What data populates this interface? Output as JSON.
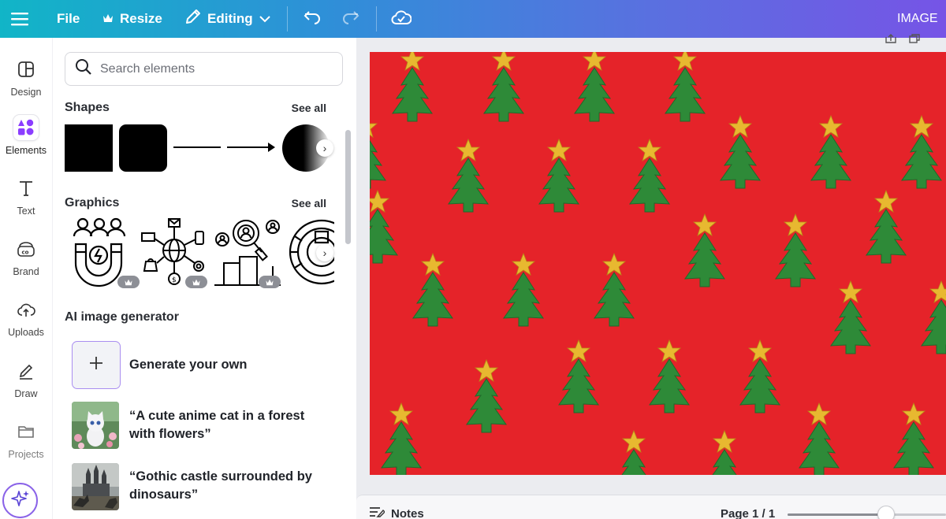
{
  "topbar": {
    "file_label": "File",
    "resize_label": "Resize",
    "mode_label": "Editing",
    "title_label": "IMAGE",
    "menu_icon": "hamburger-icon",
    "crown_icon": "crown-icon",
    "pencil_icon": "pencil-icon",
    "undo_icon": "undo-icon",
    "redo_icon": "redo-icon",
    "cloud_icon": "cloud-check-icon"
  },
  "rail": {
    "items": [
      {
        "label": "Design",
        "icon": "layout-icon"
      },
      {
        "label": "Elements",
        "icon": "shapes-icon"
      },
      {
        "label": "Text",
        "icon": "text-icon"
      },
      {
        "label": "Brand",
        "icon": "brand-icon"
      },
      {
        "label": "Uploads",
        "icon": "cloud-upload-icon"
      },
      {
        "label": "Draw",
        "icon": "draw-icon"
      },
      {
        "label": "Projects",
        "icon": "folder-icon"
      }
    ],
    "active_item": "Elements",
    "magic_icon": "sparkle-icon"
  },
  "panel": {
    "search_placeholder": "Search elements",
    "shapes": {
      "title": "Shapes",
      "see_all": "See all"
    },
    "graphics": {
      "title": "Graphics",
      "see_all": "See all"
    },
    "ai": {
      "title": "AI image generator",
      "generate_label": "Generate your own",
      "prompts": [
        {
          "text": "“A cute anime cat in a forest with flowers”"
        },
        {
          "text": "“Gothic castle surrounded by dinosaurs”"
        }
      ]
    }
  },
  "footer": {
    "notes_label": "Notes",
    "page_label": "Page 1 / 1",
    "zoom_level": 0.62
  },
  "colors": {
    "canvas_background": "#e52329",
    "tree_green": "#2e8a38",
    "star_gold": "#e8b830",
    "accent_purple": "#8a63e8"
  }
}
